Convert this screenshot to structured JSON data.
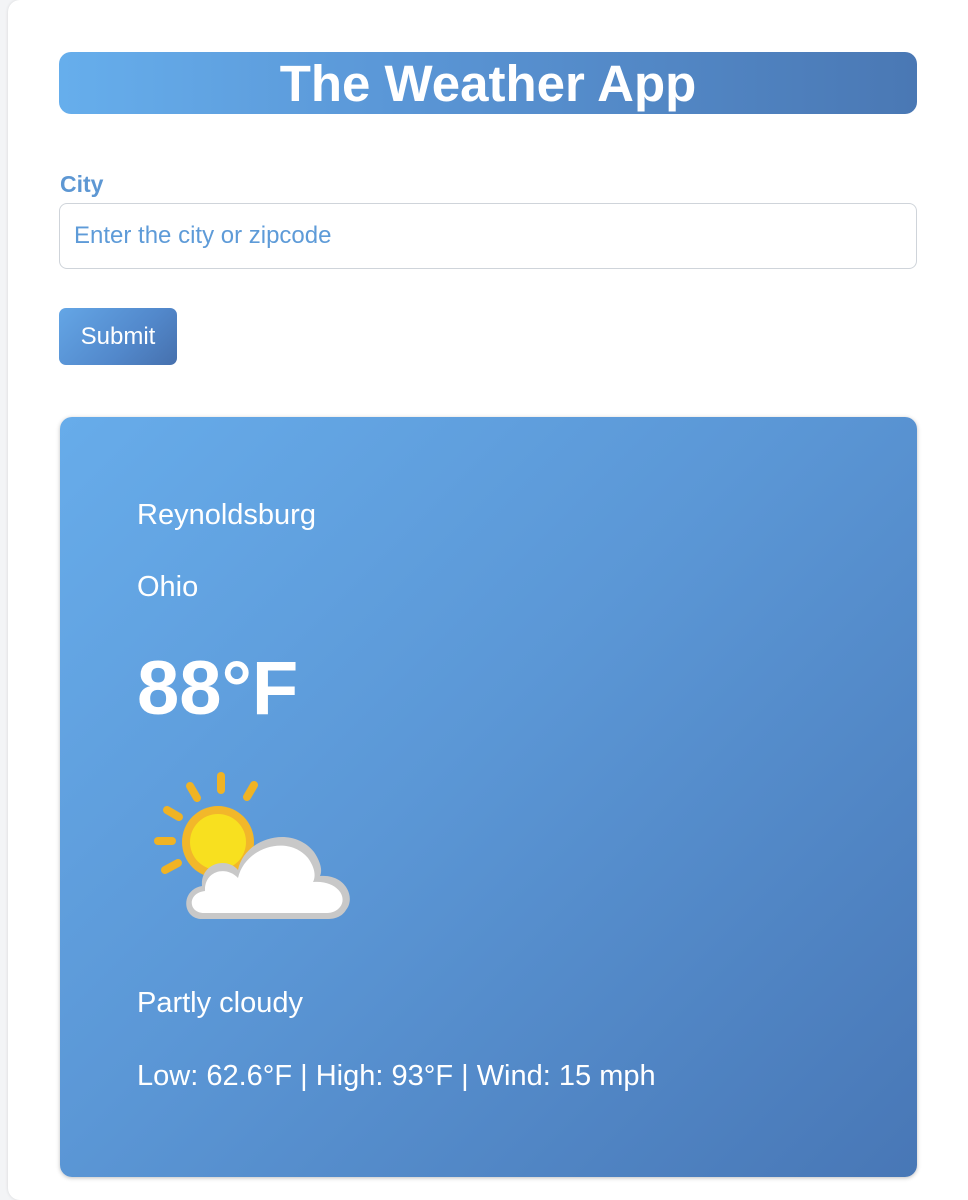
{
  "app": {
    "title": "The Weather App"
  },
  "form": {
    "city_label": "City",
    "city_placeholder": "Enter the city or zipcode",
    "city_value": "",
    "submit_label": "Submit"
  },
  "weather": {
    "city": "Reynoldsburg",
    "region": "Ohio",
    "temperature": "88°F",
    "icon": "partly-cloudy-icon",
    "condition": "Partly cloudy",
    "details": "Low: 62.6°F | High: 93°F | Wind: 15 mph"
  },
  "colors": {
    "accent": "#5d97d3",
    "gradient_start": "#66aeec",
    "gradient_end": "#4877b6",
    "text_on_accent": "#ffffff"
  }
}
